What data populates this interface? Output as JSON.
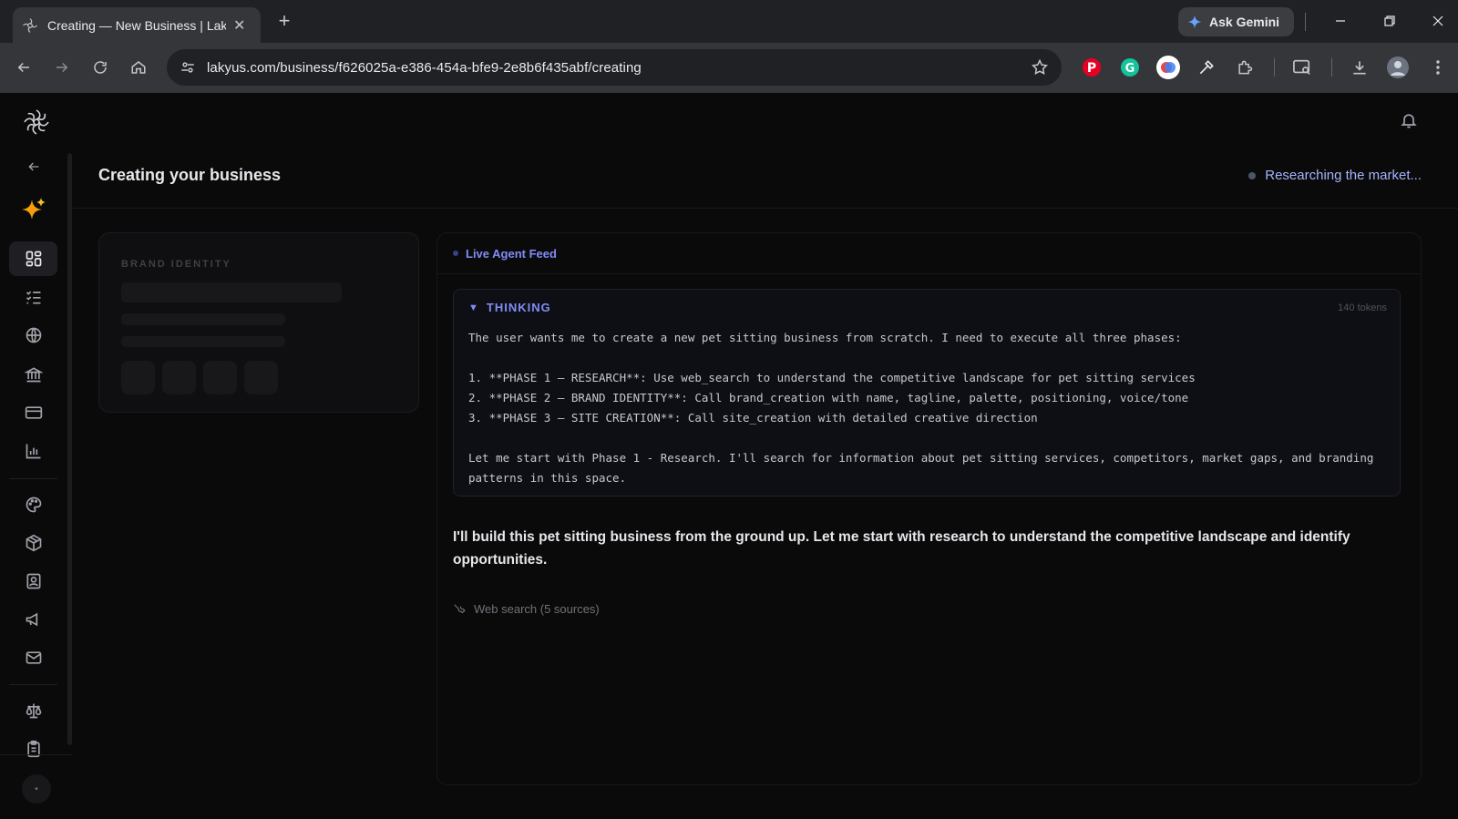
{
  "browser": {
    "tab_title": "Creating — New Business | Laky",
    "url": "lakyus.com/business/f626025a-e386-454a-bfe9-2e8b6f435abf/creating",
    "ask_gemini_label": "Ask Gemini"
  },
  "header": {
    "title": "Creating your business",
    "status": "Researching the market..."
  },
  "brand_card": {
    "label": "BRAND IDENTITY"
  },
  "feed": {
    "title": "Live Agent Feed",
    "thinking": {
      "title": "THINKING",
      "tokens": "140 tokens",
      "line1": "The user wants me to create a new pet sitting business from scratch. I need to execute all three phases:",
      "line2": "1. **PHASE 1 — RESEARCH**: Use web_search to understand the competitive landscape for pet sitting services",
      "line3": "2. **PHASE 2 — BRAND IDENTITY**: Call brand_creation with name, tagline, palette, positioning, voice/tone",
      "line4": "3. **PHASE 3 — SITE CREATION**: Call site_creation with detailed creative direction",
      "line5": "Let me start with Phase 1 - Research. I'll search for information about pet sitting services, competitors, market gaps, and branding patterns in this space."
    },
    "reply": "I'll build this pet sitting business from the ground up. Let me start with research to understand the competitive landscape and identify opportunities.",
    "tool_call": "Web search (5 sources)"
  },
  "colors": {
    "accent": "#818cf8",
    "background": "#0a0a0a",
    "status_text": "#a5b4fc"
  }
}
